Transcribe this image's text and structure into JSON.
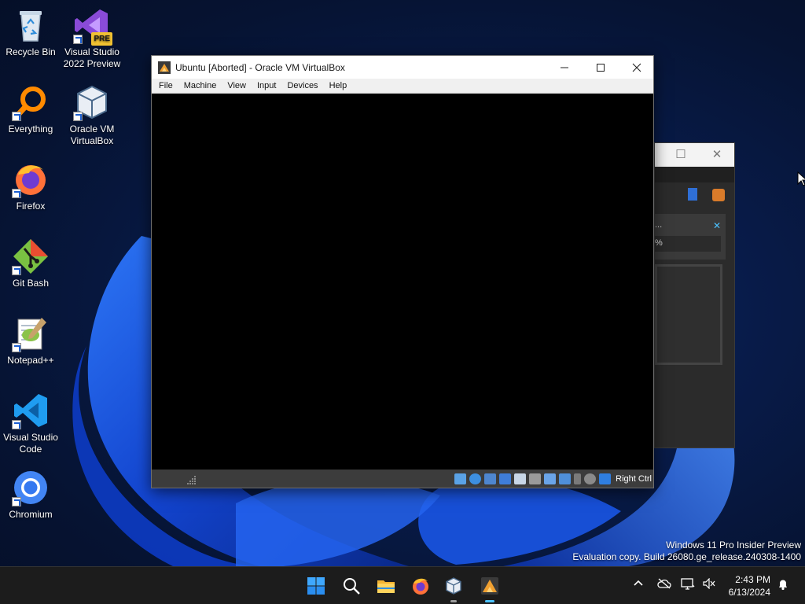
{
  "desktop": {
    "icons": [
      {
        "label": "Recycle Bin"
      },
      {
        "label": "Visual Studio 2022 Preview",
        "badge": "PRE"
      },
      {
        "label": "Everything"
      },
      {
        "label": "Oracle VM VirtualBox"
      },
      {
        "label": "Firefox"
      },
      {
        "label": "Git Bash"
      },
      {
        "label": "Notepad++"
      },
      {
        "label": "Visual Studio Code"
      },
      {
        "label": "Chromium"
      }
    ],
    "watermark_line1": "Windows 11 Pro Insider Preview",
    "watermark_line2": "Evaluation copy. Build 26080.ge_release.240308-1400"
  },
  "vbox_window": {
    "title": "Ubuntu [Aborted] - Oracle VM VirtualBox",
    "menu": [
      "File",
      "Machine",
      "View",
      "Input",
      "Devices",
      "Help"
    ],
    "host_key": "Right Ctrl",
    "status_icons": [
      "hard-disk-icon",
      "optical-drive-icon",
      "audio-icon",
      "network-icon",
      "usb-icon",
      "shared-folders-icon",
      "display-icon",
      "video-capture-icon",
      "cpu-icon",
      "mouse-integration-icon",
      "keyboard-icon"
    ]
  },
  "bg_window": {
    "partial_text": "...",
    "percent_fragment": "%"
  },
  "taskbar": {
    "apps": [
      "start-icon",
      "search-icon",
      "file-explorer-icon",
      "firefox-icon",
      "virtualbox-icon",
      "virtualbox-vm-icon"
    ],
    "time": "2:43 PM",
    "date": "6/13/2024"
  },
  "colors": {
    "accent": "#4cc2ff",
    "taskbar": "#1c1c1c",
    "wallpaper_blue": "#1a56e8"
  }
}
